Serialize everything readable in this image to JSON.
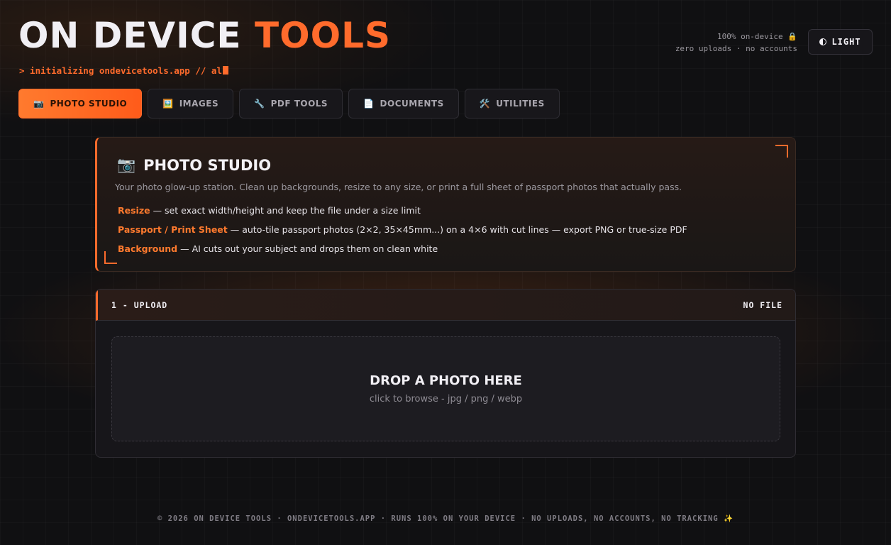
{
  "header": {
    "logo_main": "ON DEVICE ",
    "logo_accent": "TOOLS",
    "terminal_text": "> initializing ondevicetools.app // al",
    "status_line1": "100% on-device 🔒",
    "status_line2": "zero uploads · no accounts",
    "theme_button": "LIGHT"
  },
  "tabs": [
    {
      "icon": "📷",
      "label": "PHOTO STUDIO",
      "active": true
    },
    {
      "icon": "🖼️",
      "label": "IMAGES",
      "active": false
    },
    {
      "icon": "🔧",
      "label": "PDF TOOLS",
      "active": false
    },
    {
      "icon": "📄",
      "label": "DOCUMENTS",
      "active": false
    },
    {
      "icon": "🛠️",
      "label": "UTILITIES",
      "active": false
    }
  ],
  "hero": {
    "icon": "📷",
    "title": "PHOTO STUDIO",
    "subtitle": "Your photo glow-up station. Clean up backgrounds, resize to any size, or print a full sheet of passport photos that actually pass.",
    "features": [
      {
        "name": "Resize",
        "desc": " — set exact width/height and keep the file under a size limit"
      },
      {
        "name": "Passport / Print Sheet",
        "desc": " — auto-tile passport photos (2×2, 35×45mm...) on a 4×6 with cut lines — export PNG or true-size PDF"
      },
      {
        "name": "Background",
        "desc": " — AI cuts out your subject and drops them on clean white"
      }
    ]
  },
  "upload": {
    "step_label": "1 - UPLOAD",
    "file_status": "NO FILE",
    "drop_title": "DROP A PHOTO HERE",
    "drop_hint": "click to browse - jpg / png / webp"
  },
  "footer": {
    "text": "© 2026 ON DEVICE TOOLS · ONDEVICETOOLS.APP · RUNS 100% ON YOUR DEVICE · NO UPLOADS, NO ACCOUNTS, NO TRACKING ✨"
  },
  "colors": {
    "accent": "#ff6b2c",
    "background": "#101012",
    "panel": "#17161a"
  }
}
